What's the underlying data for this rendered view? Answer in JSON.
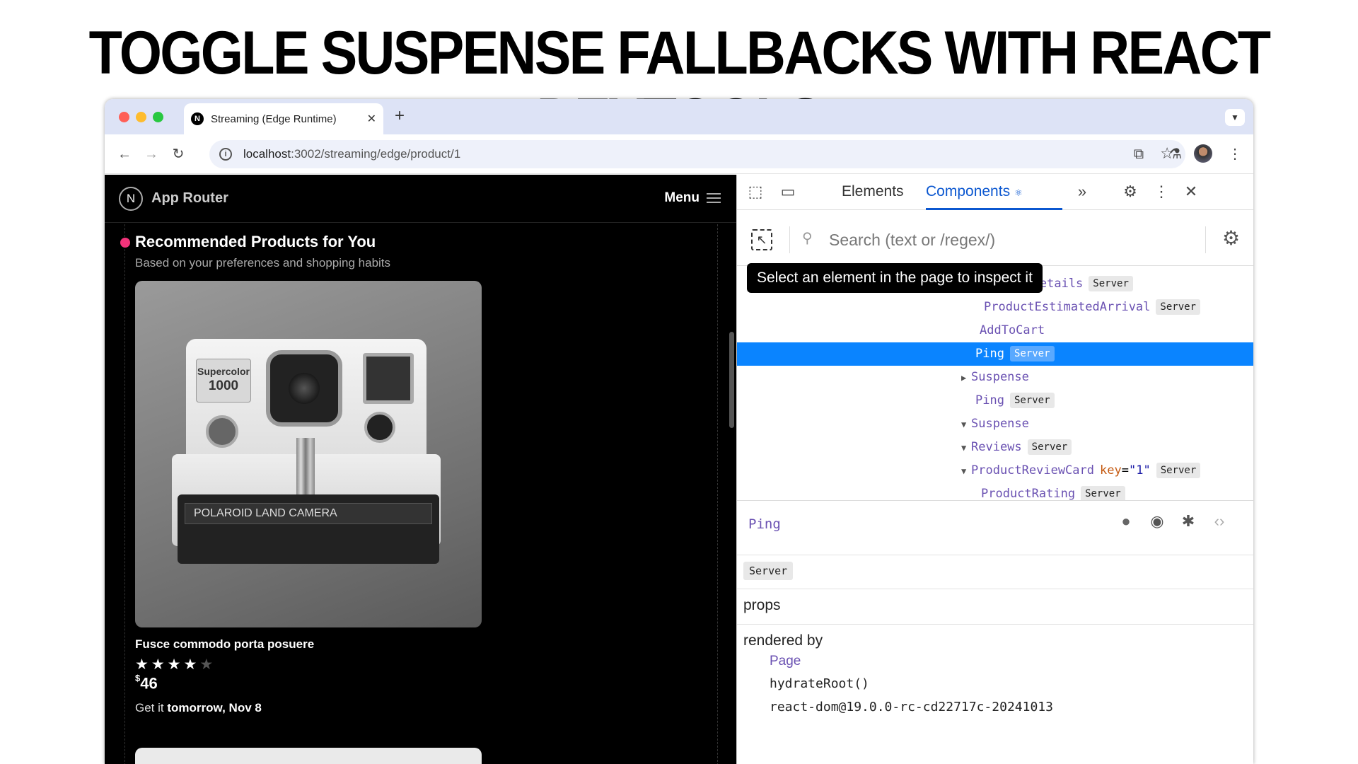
{
  "slide_title": "TOGGLE SUSPENSE FALLBACKS WITH REACT DEVTOOLS",
  "browser": {
    "tab_title": "Streaming (Edge Runtime)",
    "tab_favicon": "N",
    "url_host": "localhost",
    "url_rest": ":3002/streaming/edge/product/1"
  },
  "app": {
    "logo": "N",
    "name": "App Router",
    "menu_label": "Menu",
    "section_title": "Recommended Products for You",
    "section_subtitle": "Based on your preferences and shopping habits",
    "product": {
      "image_badge_line1": "Supercolor",
      "image_badge_line2": "1000",
      "image_label": "POLAROID LAND CAMERA",
      "name": "Fusce commodo porta posuere",
      "rating": 4,
      "rating_max": 5,
      "currency": "$",
      "price": "46",
      "delivery_prefix": "Get it ",
      "delivery_date": "tomorrow, Nov 8"
    }
  },
  "devtools": {
    "tabs": [
      "Elements",
      "Components"
    ],
    "active_tab": "Components",
    "search_placeholder": "Search (text or /regex/)",
    "tooltip": "Select an element in the page to inspect it",
    "tree": [
      {
        "name": "ProductDetails",
        "badge": "Server",
        "arrow": ""
      },
      {
        "name": "ProductEstimatedArrival",
        "badge": "Server",
        "arrow": ""
      },
      {
        "name": "AddToCart",
        "badge": "",
        "arrow": ""
      },
      {
        "name": "Ping",
        "badge": "Server",
        "arrow": "",
        "selected": true
      },
      {
        "name": "Suspense",
        "badge": "",
        "arrow": "right"
      },
      {
        "name": "Ping",
        "badge": "Server",
        "arrow": ""
      },
      {
        "name": "Suspense",
        "badge": "",
        "arrow": "down"
      },
      {
        "name": "Reviews",
        "badge": "Server",
        "arrow": "down"
      },
      {
        "name": "ProductReviewCard",
        "key_label": "key",
        "key_value": "\"1\"",
        "badge": "Server",
        "arrow": "down"
      },
      {
        "name": "ProductRating",
        "badge": "Server",
        "arrow": ""
      }
    ],
    "detail": {
      "component": "Ping",
      "badge": "Server",
      "props_label": "props",
      "rendered_by_label": "rendered by",
      "rendered_by": [
        "Page",
        "hydrateRoot()",
        "react-dom@19.0.0-rc-cd22717c-20241013"
      ]
    }
  }
}
